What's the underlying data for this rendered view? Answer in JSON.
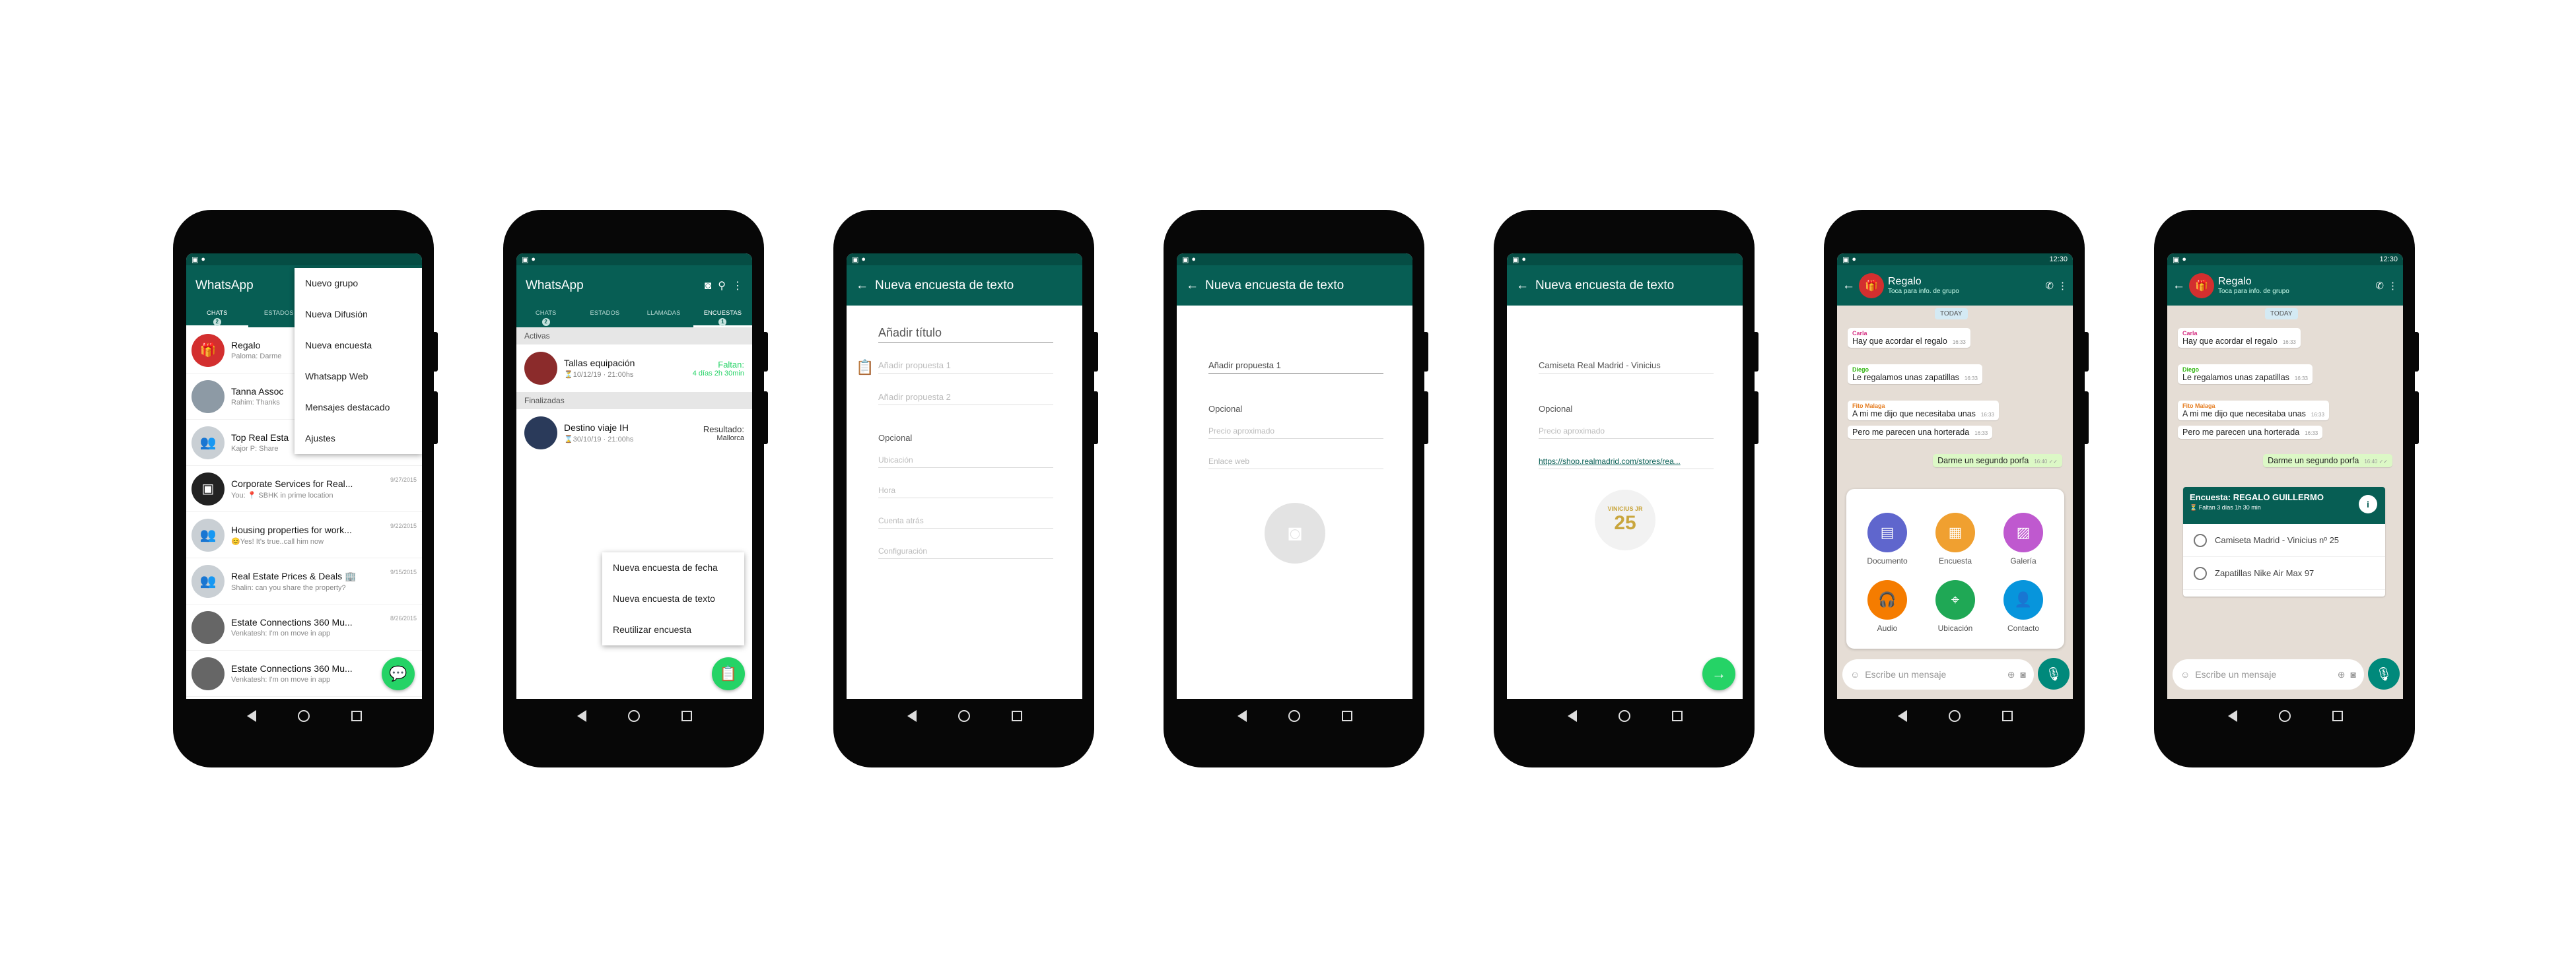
{
  "status": {
    "time": "12:30"
  },
  "phone1": {
    "title": "WhatsApp",
    "tabs": [
      {
        "label": "CHATS",
        "badge": "2"
      },
      {
        "label": "ESTADOS"
      }
    ],
    "chats": [
      {
        "name": "Regalo",
        "msg": "Paloma: Darme"
      },
      {
        "name": "Tanna Assoc",
        "msg": "Rahim: Thanks"
      },
      {
        "name": "Top Real Esta",
        "msg": "Kajor P: Share"
      },
      {
        "name": "Corporate Services for Real...",
        "msg": "You: 📍 SBHK in prime location",
        "date": "9/27/2015"
      },
      {
        "name": "Housing properties for work...",
        "msg": "😊Yes! It's true..call him now",
        "date": "9/22/2015"
      },
      {
        "name": "Real Estate Prices & Deals 🏢",
        "msg": "Shalin: can you share the property?",
        "date": "9/15/2015"
      },
      {
        "name": "Estate Connections 360 Mu...",
        "msg": "Venkatesh: I'm on move in app",
        "date": "8/26/2015"
      },
      {
        "name": "Estate Connections 360 Mu...",
        "msg": "Venkatesh: I'm on move in app"
      }
    ],
    "menu": [
      "Nuevo grupo",
      "Nueva Difusión",
      "Nueva encuesta",
      "Whatsapp Web",
      "Mensajes destacado",
      "Ajustes"
    ]
  },
  "phone2": {
    "title": "WhatsApp",
    "tabs": [
      {
        "label": "CHATS",
        "badge": "2"
      },
      {
        "label": "ESTADOS"
      },
      {
        "label": "LLAMADAS"
      },
      {
        "label": "ENCUESTAS",
        "badge": "1"
      }
    ],
    "sections": {
      "active": "Activas",
      "finished": "Finalizadas"
    },
    "polls": [
      {
        "name": "Tallas equipación",
        "date": "⏳10/12/19 · 21:00hs",
        "status_label": "Faltan:",
        "status_value": "4 días 2h 30min"
      },
      {
        "name": "Destino viaje IH",
        "date": "⌛30/10/19 · 21:00hs",
        "status_label": "Resultado:",
        "status_value": "Mallorca"
      }
    ],
    "menu": [
      "Nueva encuesta de fecha",
      "Nueva encuesta de texto",
      "Reutilizar encuesta"
    ]
  },
  "phone3": {
    "title": "Nueva encuesta de texto",
    "heading": "Añadir título",
    "fields": [
      "Añadir propuesta 1",
      "Añadir propuesta 2"
    ],
    "optional": "Opcional",
    "optional_fields": [
      "Ubicación",
      "Hora",
      "Cuenta atrás",
      "Configuración"
    ]
  },
  "phone4": {
    "title": "Nueva encuesta de texto",
    "field": "Añadir propuesta 1",
    "optional": "Opcional",
    "optional_fields": [
      "Precio aproximado",
      "Enlace web"
    ]
  },
  "phone5": {
    "title": "Nueva encuesta de texto",
    "field": "Camiseta Real Madrid - Vinicius",
    "optional": "Opcional",
    "optional_fields": [
      "Precio aproximado"
    ],
    "link": "https://shop.realmadrid.com/stores/rea...",
    "shirt_name": "VINICIUS JR",
    "shirt_number": "25"
  },
  "chat": {
    "name": "Regalo",
    "subtitle": "Toca para info. de grupo",
    "day": "TODAY",
    "messages": [
      {
        "sender": "Carla",
        "text": "Hay que acordar el regalo",
        "time": "16:33"
      },
      {
        "sender": "Diego",
        "text": "Le regalamos unas zapatillas",
        "time": "16:33"
      },
      {
        "sender": "Fito Malaga",
        "text": "A mi me dijo que necesitaba unas",
        "time": "16:33"
      },
      {
        "text": "Pero me parecen una horterada",
        "time": "16:33"
      },
      {
        "text": "Darme un segundo porfa",
        "time": "16:40 ✓✓"
      }
    ],
    "input_placeholder": "Escribe un mensaje",
    "attach": [
      {
        "label": "Documento",
        "color": "#5f66cd"
      },
      {
        "label": "Encuesta",
        "color": "#f0a030"
      },
      {
        "label": "Galería",
        "color": "#bf59cf"
      },
      {
        "label": "Audio",
        "color": "#f57c00"
      },
      {
        "label": "Ubicación",
        "color": "#1fa855"
      },
      {
        "label": "Contacto",
        "color": "#0795dc"
      }
    ],
    "poll": {
      "title": "Encuesta: REGALO GUILLERMO",
      "remaining": "⏳ Faltan 3 días 1h 30 min",
      "options": [
        "Camiseta Madrid - Vinicius nº 25",
        "Zapatillas Nike Air Max 97"
      ]
    }
  },
  "colors": {
    "header": "#075e54",
    "accent": "#25d366"
  }
}
